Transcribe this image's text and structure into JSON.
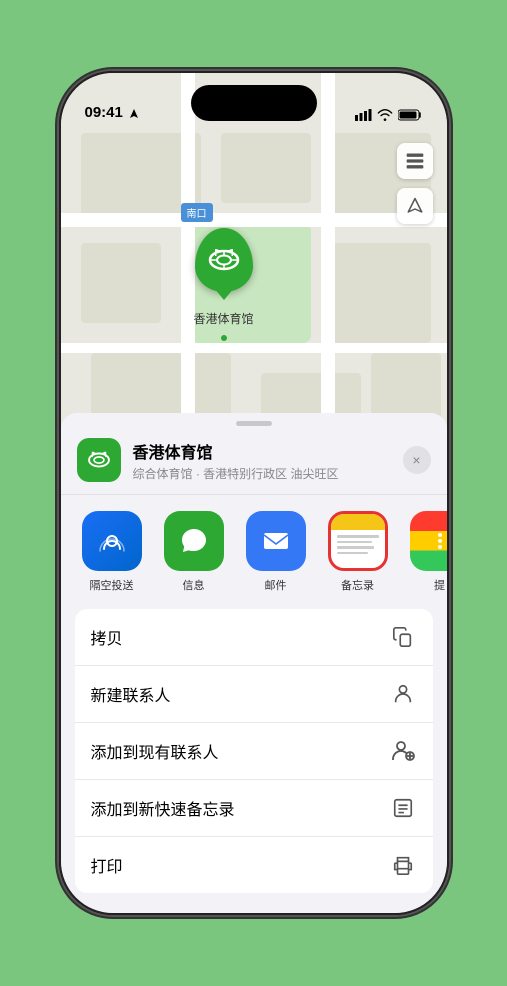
{
  "status": {
    "time": "09:41",
    "location_arrow": true
  },
  "map": {
    "label_text": "南口",
    "stadium_label": "香港体育馆",
    "controls": [
      "map-layer-icon",
      "location-icon"
    ]
  },
  "location_card": {
    "name": "香港体育馆",
    "address": "综合体育馆 · 香港特别行政区 油尖旺区",
    "close_label": "×"
  },
  "share_items": [
    {
      "id": "airdrop",
      "label": "隔空投送"
    },
    {
      "id": "messages",
      "label": "信息"
    },
    {
      "id": "mail",
      "label": "邮件"
    },
    {
      "id": "notes",
      "label": "备忘录"
    },
    {
      "id": "more",
      "label": "提"
    }
  ],
  "actions": [
    {
      "label": "拷贝",
      "icon": "copy"
    },
    {
      "label": "新建联系人",
      "icon": "person"
    },
    {
      "label": "添加到现有联系人",
      "icon": "person-add"
    },
    {
      "label": "添加到新快速备忘录",
      "icon": "note"
    },
    {
      "label": "打印",
      "icon": "print"
    }
  ]
}
